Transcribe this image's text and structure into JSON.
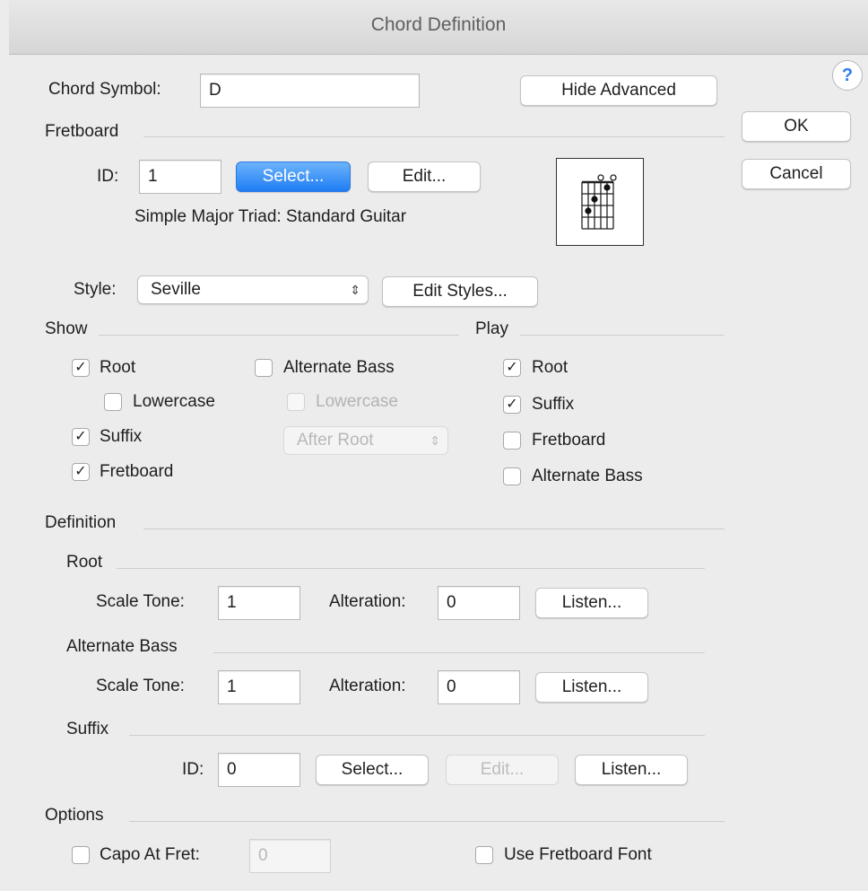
{
  "window": {
    "title": "Chord Definition"
  },
  "chord_symbol": {
    "label": "Chord Symbol:",
    "value": "D"
  },
  "hide_advanced_label": "Hide Advanced",
  "ok_label": "OK",
  "cancel_label": "Cancel",
  "help_label": "?",
  "fretboard": {
    "heading": "Fretboard",
    "id_label": "ID:",
    "id_value": "1",
    "select_label": "Select...",
    "edit_label": "Edit...",
    "description": "Simple Major Triad:  Standard Guitar"
  },
  "style": {
    "label": "Style:",
    "value": "Seville",
    "edit_label": "Edit Styles..."
  },
  "show": {
    "heading": "Show",
    "root": {
      "label": "Root",
      "checked": true
    },
    "lowercase": {
      "label": "Lowercase",
      "checked": false
    },
    "suffix": {
      "label": "Suffix",
      "checked": true
    },
    "fretboard": {
      "label": "Fretboard",
      "checked": true
    },
    "alternate_bass": {
      "label": "Alternate Bass",
      "checked": false
    },
    "alt_lowercase": {
      "label": "Lowercase",
      "checked": false
    },
    "position": "After Root"
  },
  "play": {
    "heading": "Play",
    "root": {
      "label": "Root",
      "checked": true
    },
    "suffix": {
      "label": "Suffix",
      "checked": true
    },
    "fretboard": {
      "label": "Fretboard",
      "checked": false
    },
    "alternate_bass": {
      "label": "Alternate Bass",
      "checked": false
    }
  },
  "definition": {
    "heading": "Definition",
    "root": {
      "heading": "Root",
      "scale_tone_label": "Scale Tone:",
      "scale_tone": "1",
      "alteration_label": "Alteration:",
      "alteration": "0",
      "listen_label": "Listen..."
    },
    "alt_bass": {
      "heading": "Alternate Bass",
      "scale_tone_label": "Scale Tone:",
      "scale_tone": "1",
      "alteration_label": "Alteration:",
      "alteration": "0",
      "listen_label": "Listen..."
    },
    "suffix": {
      "heading": "Suffix",
      "id_label": "ID:",
      "id_value": "0",
      "select_label": "Select...",
      "edit_label": "Edit...",
      "listen_label": "Listen..."
    }
  },
  "options": {
    "heading": "Options",
    "capo": {
      "label": "Capo At Fret:",
      "checked": false,
      "value": "0"
    },
    "fretboard_font": {
      "label": "Use Fretboard Font",
      "checked": false
    }
  },
  "check_glyph": "✓",
  "colors": {
    "primary_button": "#1f7df5",
    "dialog_bg": "#ececec"
  }
}
